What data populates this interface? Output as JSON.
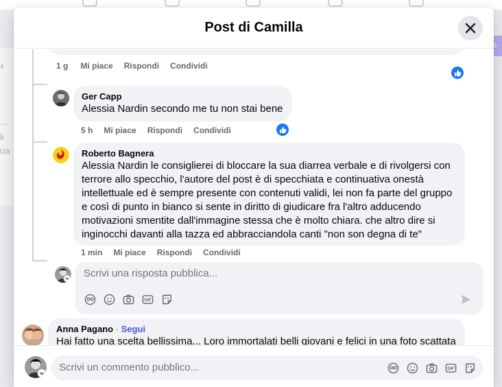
{
  "modal": {
    "title": "Post di Camilla"
  },
  "background": {
    "left_fragments": [
      "4",
      "...",
      "k",
      "ua"
    ],
    "right_fragment": "p"
  },
  "previous_comment": {
    "time": "1 g",
    "like": "Mi piace",
    "reply": "Rispondi",
    "share": "Condividi"
  },
  "comments": [
    {
      "author": "Ger Capp",
      "text": "Alessia Nardin secondo me tu non stai bene",
      "time": "5 h",
      "like": "Mi piace",
      "reply": "Rispondi",
      "share": "Condividi"
    },
    {
      "author": "Roberto Bagnera",
      "text_lines": [
        "Alessia Nardin le consiglierei di bloccare la sua diarrea verbale e di rivolgersi con",
        "terrore allo specchio, l'autore del post è di specchiata e continuativa onestà",
        "intellettuale ed è sempre presente con contenuti validi, lei non fa parte del gruppo",
        "e così di punto in bianco si sente in diritto di giudicare fra l'altro adducendo",
        "motivazioni smentite dall'immagine stessa che è molto chiara. che altro dire si",
        "inginocchi davanti alla tazza ed abbracciandola canti \"non son degna di te\""
      ],
      "time": "1 min",
      "like": "Mi piace",
      "reply": "Rispondi",
      "share": "Condividi"
    }
  ],
  "reply_box": {
    "placeholder": "Scrivi una risposta pubblica..."
  },
  "next_comment": {
    "author": "Anna Pagano",
    "separator": " · ",
    "follow": "Segui",
    "text": "Hai fatto una scelta bellissima... Loro immortalati belli giovani e felici in una foto scattata"
  },
  "footer": {
    "placeholder": "Scrivi un commento pubblico..."
  },
  "colors": {
    "accent": "#1877f2",
    "follow": "#4c5bd4",
    "bubble": "#f0f2f5"
  },
  "icons": [
    "close-icon",
    "like-icon",
    "avatar-sticker-icon",
    "emoji-icon",
    "camera-icon",
    "gif-icon",
    "sticker-icon",
    "send-icon"
  ]
}
